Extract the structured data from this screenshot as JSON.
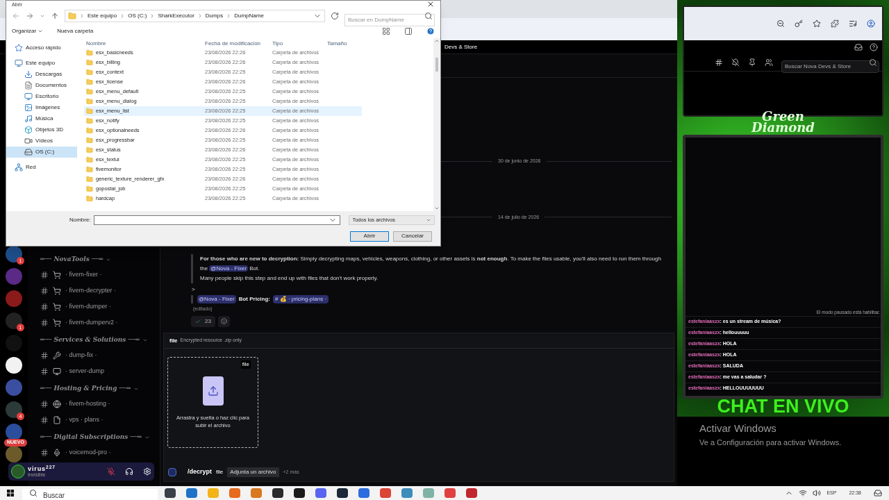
{
  "dialog": {
    "title": "Abrir",
    "path": [
      "Este equipo",
      "OS (C:)",
      "SharkExecutor",
      "Dumps",
      "DumpName"
    ],
    "search_placeholder": "Buscar en DumpName",
    "toolbar": [
      "Organizar",
      "Nueva carpeta"
    ],
    "nav": [
      {
        "label": "Acceso rápido",
        "kind": "star",
        "selected": false
      },
      {
        "label": "Este equipo",
        "kind": "pc",
        "selected": false,
        "children": [
          {
            "label": "Descargas",
            "kind": "download",
            "selected": false
          },
          {
            "label": "Documentos",
            "kind": "doc",
            "selected": false
          },
          {
            "label": "Escritorio",
            "kind": "desktop",
            "selected": false
          },
          {
            "label": "Imágenes",
            "kind": "images",
            "selected": false
          },
          {
            "label": "Música",
            "kind": "music",
            "selected": false
          },
          {
            "label": "Objetos 3D",
            "kind": "cube",
            "selected": false
          },
          {
            "label": "Vídeos",
            "kind": "video",
            "selected": false
          },
          {
            "label": "OS (C:)",
            "kind": "drive",
            "selected": true
          }
        ]
      },
      {
        "label": "Red",
        "kind": "network",
        "selected": false
      }
    ],
    "columns": [
      "Nombre",
      "Fecha de modificación",
      "Tipo",
      "Tamaño"
    ],
    "files": [
      {
        "name": "esx_basicneeds",
        "modified": "23/08/2026 22:26",
        "type": "Carpeta de archivos",
        "selected": false
      },
      {
        "name": "esx_billing",
        "modified": "23/08/2026 22:26",
        "type": "Carpeta de archivos",
        "selected": false
      },
      {
        "name": "esx_context",
        "modified": "23/08/2026 22:25",
        "type": "Carpeta de archivos",
        "selected": false
      },
      {
        "name": "esx_license",
        "modified": "23/08/2026 22:26",
        "type": "Carpeta de archivos",
        "selected": false
      },
      {
        "name": "esx_menu_default",
        "modified": "23/08/2026 22:25",
        "type": "Carpeta de archivos",
        "selected": false
      },
      {
        "name": "esx_menu_dialog",
        "modified": "23/08/2026 22:25",
        "type": "Carpeta de archivos",
        "selected": false
      },
      {
        "name": "esx_menu_list",
        "modified": "23/08/2026 22:25",
        "type": "Carpeta de archivos",
        "selected": true
      },
      {
        "name": "esx_notify",
        "modified": "23/08/2026 22:25",
        "type": "Carpeta de archivos",
        "selected": false
      },
      {
        "name": "esx_optionalneeds",
        "modified": "23/08/2026 22:26",
        "type": "Carpeta de archivos",
        "selected": false
      },
      {
        "name": "esx_progressbar",
        "modified": "23/08/2026 22:25",
        "type": "Carpeta de archivos",
        "selected": false
      },
      {
        "name": "esx_status",
        "modified": "23/08/2026 22:26",
        "type": "Carpeta de archivos",
        "selected": false
      },
      {
        "name": "esx_textui",
        "modified": "23/08/2026 22:25",
        "type": "Carpeta de archivos",
        "selected": false
      },
      {
        "name": "fivemonitor",
        "modified": "23/08/2026 22:25",
        "type": "Carpeta de archivos",
        "selected": false
      },
      {
        "name": "generic_texture_renderer_gfx",
        "modified": "23/08/2026 22:26",
        "type": "Carpeta de archivos",
        "selected": false
      },
      {
        "name": "gopostal_job",
        "modified": "23/08/2026 22:25",
        "type": "Carpeta de archivos",
        "selected": false
      },
      {
        "name": "hardcap",
        "modified": "23/08/2026 22:25",
        "type": "Carpeta de archivos",
        "selected": false
      }
    ],
    "filename_label": "Nombre:",
    "filter": "Todos los archivos",
    "buttons": [
      "Abrir",
      "Cancelar"
    ]
  },
  "server_header": "Devs & Store",
  "servers": [
    {
      "color": "#1d4e89",
      "badge": "1"
    },
    {
      "color": "#5b2a86"
    },
    {
      "color": "#8b1a1a"
    },
    {
      "color": "#222222",
      "badge": "1"
    },
    {
      "color": "#111111"
    },
    {
      "color": "#f2f2f2"
    },
    {
      "color": "#3a4fa0"
    },
    {
      "color": "#2d3a3a",
      "badge": "4"
    },
    {
      "color": "#2a4d9c"
    },
    {
      "color": "#6b5a2a"
    }
  ],
  "new_badge": "NUEVO",
  "categories": [
    {
      "name": "═── NovaTools ──═",
      "channels": [
        {
          "kind": "cart",
          "name": "· fivem-fixer ·"
        },
        {
          "kind": "cart",
          "name": "· fivem-decrypter ·"
        },
        {
          "kind": "cart",
          "name": "· fivem-dumper ·"
        },
        {
          "kind": "cart",
          "name": "· fivem-dumperv2 ·"
        }
      ]
    },
    {
      "name": "═── Services & Solutions ──═",
      "channels": [
        {
          "kind": "tools",
          "name": "· dump-fix ·"
        },
        {
          "kind": "monitor",
          "name": "· server-dump"
        }
      ]
    },
    {
      "name": "═── Hosting & Pricing ──═",
      "channels": [
        {
          "kind": "globe",
          "name": "· fivem-hosting ·"
        },
        {
          "kind": "page",
          "name": "· vps · plans ·"
        }
      ]
    },
    {
      "name": "═── Digital Subscriptions ──═",
      "channels": [
        {
          "kind": "mic",
          "name": "· voicemod-pro ·"
        }
      ]
    }
  ],
  "user": {
    "name": "virus$^{227}$",
    "status": "Invisible"
  },
  "dates": [
    "30 de junio de 2026",
    "14 de julio de 2026"
  ],
  "message": {
    "text_before": "**For those who are new to decryption:** Simply decrypting maps, vehicles, weapons, clothing, or other assets is **not enough**. To make the files usable, you'll also need to run them through the",
    "mention": "@Nova - Fixer",
    "text_after": "Bot.",
    "line2": "Many people skip this step and end up with files that don't work properly.",
    "quote_mark": ">",
    "pricing_mention": "@Nova - Fixer",
    "pricing_label": "Bot Pricing:",
    "pricing_channel": "# 💰 · pricing-plans ·",
    "edited": "(editado)",
    "reaction_count": "23"
  },
  "command": {
    "option": "file",
    "option_desc": "Encrypted resource .zip only",
    "upload_badge": "file",
    "upload_hint": "Arrastra y suelta o haz clic para subir el archivo",
    "name": "/decrypt",
    "arg_name": "file",
    "arg_value": "Adjunta un archivo",
    "more": "+2 más"
  },
  "overlay": {
    "search_placeholder": "Buscar Nova Devs & Store",
    "logo": [
      "Green",
      "Diamond"
    ],
    "paused_notice": "El modo pausado está habilitac",
    "chat": [
      {
        "user": "estefaniaaszx",
        "text": ": es un stream de música?"
      },
      {
        "user": "estefaniaaszx",
        "text": ": hellouuuuu"
      },
      {
        "user": "estefaniaaszx",
        "text": ": HOLA"
      },
      {
        "user": "estefaniaaszx",
        "text": ": HOLA"
      },
      {
        "user": "estefaniaaszx",
        "text": ": SALUDA"
      },
      {
        "user": "estefaniaaszx",
        "text": ": me vas a saludar ?"
      },
      {
        "user": "estefaniaaszx",
        "text": ": HELLOUUUUUUU"
      }
    ],
    "title": "CHAT EN VIVO"
  },
  "activation": {
    "title": "Activar Windows",
    "subtitle": "Ve a Configuración para activar Windows."
  },
  "taskbar": {
    "search_placeholder": "Buscar",
    "apps": [
      {
        "color": "#3b3f46"
      },
      {
        "color": "#1e73c8"
      },
      {
        "color": "#f2b418"
      },
      {
        "color": "#e86a1d"
      },
      {
        "color": "#d9781e"
      },
      {
        "color": "#2b2b2b"
      },
      {
        "color": "#1a1a1a"
      },
      {
        "color": "#5865f2"
      },
      {
        "color": "#1b2838"
      },
      {
        "color": "#2d6cdf"
      },
      {
        "color": "#db4437"
      },
      {
        "color": "#3c8dbc"
      },
      {
        "color": "#7fb3a5"
      },
      {
        "color": "#e04040"
      },
      {
        "color": "#c1272d"
      }
    ],
    "language": "ESP",
    "time": "22:38"
  }
}
